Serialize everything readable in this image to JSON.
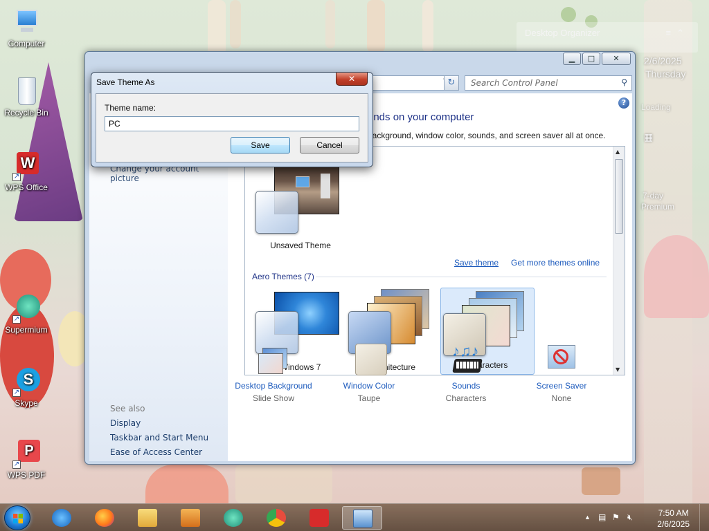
{
  "desktop": {
    "icons": [
      {
        "label": "Computer",
        "icon": "computer-icon"
      },
      {
        "label": "Recycle Bin",
        "icon": "recycle-bin-icon"
      },
      {
        "label": "WPS Office",
        "icon": "wps-office-icon"
      },
      {
        "label": "Supermium",
        "icon": "supermium-icon"
      },
      {
        "label": "Skype",
        "icon": "skype-icon"
      },
      {
        "label": "WPS PDF",
        "icon": "wps-pdf-icon"
      }
    ],
    "gadget": {
      "title": "Desktop Organizer"
    },
    "side": {
      "date": "2/6/2025",
      "day": "Thursday",
      "status": "Loading",
      "promo_line1": "7-day",
      "promo_line2": "Premium"
    }
  },
  "control_panel": {
    "search_placeholder": "Search Control Panel",
    "heading": "unds on your computer",
    "subtext": "p background, window color, sounds, and screen saver all at once.",
    "nav": {
      "partial_link": "Change your account picture",
      "see_also_title": "See also",
      "see_also": [
        "Display",
        "Taskbar and Start Menu",
        "Ease of Access Center"
      ]
    },
    "my_themes": {
      "unsaved_label": "Unsaved Theme",
      "save_link": "Save theme",
      "more_link": "Get more themes online"
    },
    "aero": {
      "group_title": "Aero Themes (7)",
      "themes": [
        {
          "name": "Windows 7",
          "selected": false
        },
        {
          "name": "Architecture",
          "selected": false
        },
        {
          "name": "Characters",
          "selected": true
        }
      ]
    },
    "bottom_tools": [
      {
        "name": "Desktop Background",
        "value": "Slide Show",
        "icon": "desktop-background-icon"
      },
      {
        "name": "Window Color",
        "value": "Taupe",
        "icon": "window-color-icon"
      },
      {
        "name": "Sounds",
        "value": "Characters",
        "icon": "sounds-icon"
      },
      {
        "name": "Screen Saver",
        "value": "None",
        "icon": "screen-saver-icon"
      }
    ]
  },
  "dialog": {
    "title": "Save Theme As",
    "label": "Theme name:",
    "value": "PC",
    "save": "Save",
    "cancel": "Cancel"
  },
  "taskbar": {
    "items": [
      "internet-explorer-icon",
      "firefox-icon",
      "file-explorer-icon",
      "media-player-icon",
      "supermium-icon",
      "chromium-icon",
      "wps-office-icon",
      "control-panel-icon"
    ],
    "time": "7:50 AM",
    "date": "2/6/2025"
  }
}
